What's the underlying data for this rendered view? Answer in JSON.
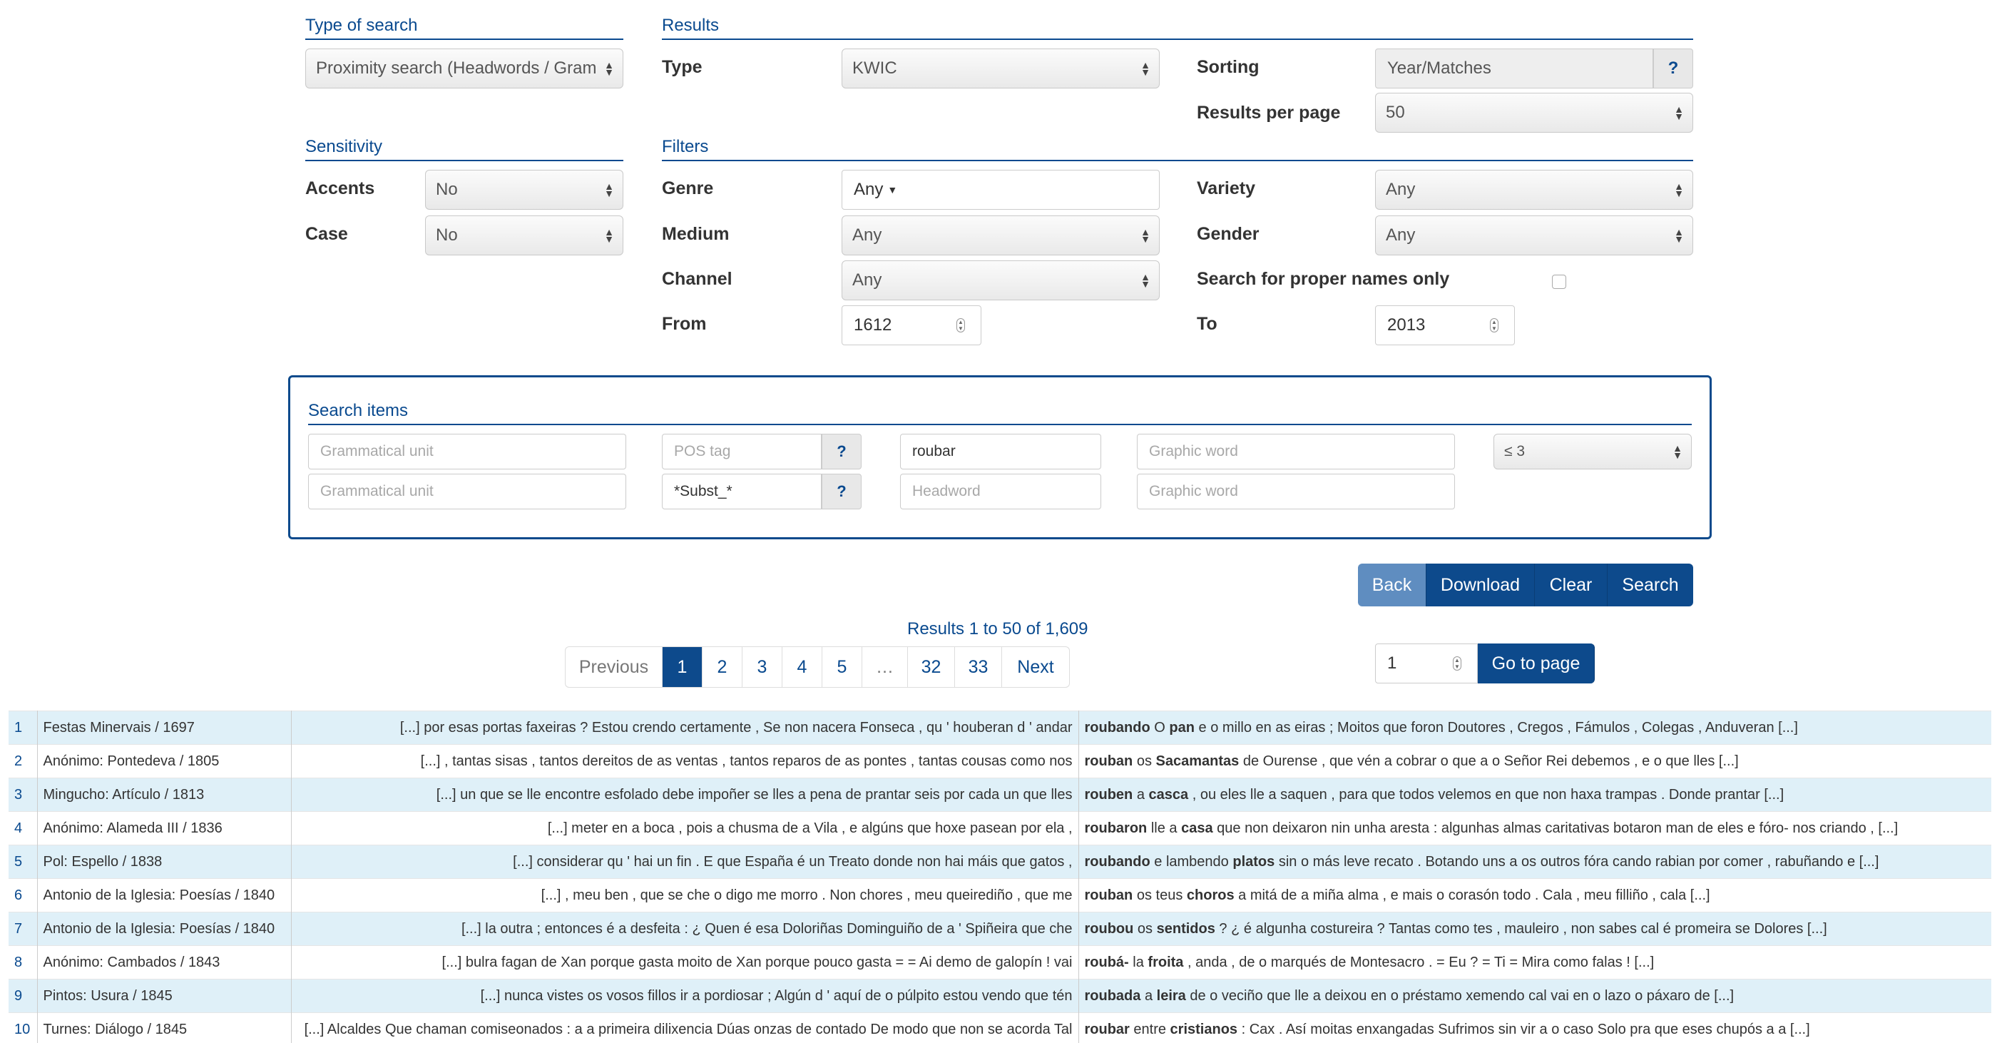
{
  "type_of_search": {
    "heading": "Type of search",
    "value": "Proximity search (Headwords / Gram"
  },
  "results": {
    "heading": "Results",
    "type_label": "Type",
    "type_value": "KWIC",
    "sorting_label": "Sorting",
    "sorting_value": "Year/Matches",
    "sorting_help": "?",
    "per_page_label": "Results per page",
    "per_page_value": "50"
  },
  "sensitivity": {
    "heading": "Sensitivity",
    "accents_label": "Accents",
    "accents_value": "No",
    "case_label": "Case",
    "case_value": "No"
  },
  "filters": {
    "heading": "Filters",
    "genre_label": "Genre",
    "genre_value": "Any",
    "variety_label": "Variety",
    "variety_value": "Any",
    "medium_label": "Medium",
    "medium_value": "Any",
    "gender_label": "Gender",
    "gender_value": "Any",
    "channel_label": "Channel",
    "channel_value": "Any",
    "proper_names_label": "Search for proper names only",
    "from_label": "From",
    "from_value": "1612",
    "to_label": "To",
    "to_value": "2013"
  },
  "search_items": {
    "heading": "Search items",
    "row1": {
      "gram_unit": "Grammatical unit",
      "pos_tag": "POS tag",
      "help": "?",
      "headword": "roubar",
      "graphic_word": "Graphic word",
      "distance": "≤ 3"
    },
    "row2": {
      "gram_unit": "Grammatical unit",
      "pos_tag": "*Subst_*",
      "help": "?",
      "headword": "Headword",
      "graphic_word": "Graphic word"
    }
  },
  "buttons": {
    "back": "Back",
    "download": "Download",
    "clear": "Clear",
    "search": "Search",
    "go_to_page": "Go to page",
    "page_input": "1"
  },
  "summary": "Results 1 to 50 of 1,609",
  "pagination": {
    "previous": "Previous",
    "pages": [
      "1",
      "2",
      "3",
      "4",
      "5",
      "…",
      "32",
      "33"
    ],
    "next": "Next"
  },
  "rows": [
    {
      "n": "1",
      "src": "Festas Minervais / 1697",
      "left": "[...] por esas portas faxeiras ? Estou crendo certamente , Se non nacera Fonseca , qu ' houberan d ' andar",
      "kw": "roubando",
      "mid": " O ",
      "kw2": "pan",
      "rest": " e o millo en as eiras ; Moitos que foron Doutores , Cregos , Fámulos , Colegas , Anduveran [...]"
    },
    {
      "n": "2",
      "src": "Anónimo: Pontedeva / 1805",
      "left": "[...] , tantas sisas , tantos dereitos de as ventas , tantos reparos de as pontes , tantas cousas como nos",
      "kw": "rouban",
      "mid": " os ",
      "kw2": "Sacamantas",
      "rest": " de Ourense , que vén a cobrar o que a o Señor Rei debemos , e o que lles [...]"
    },
    {
      "n": "3",
      "src": "Mingucho: Artículo / 1813",
      "left": "[...] un que se lle encontre esfolado debe impoñer se lles a pena de prantar seis por cada un que lles",
      "kw": "rouben",
      "mid": " a ",
      "kw2": "casca",
      "rest": " , ou eles lle a saquen , para que todos velemos en que non haxa trampas . Donde prantar [...]"
    },
    {
      "n": "4",
      "src": "Anónimo: Alameda III / 1836",
      "left": "[...] meter en a boca , pois a chusma de a Vila , e algúns que hoxe pasean por ela ,",
      "kw": "roubaron",
      "mid": " lle a ",
      "kw2": "casa",
      "rest": " que non deixaron nin unha aresta : algunhas almas caritativas botaron man de eles e fóro- nos criando , [...]"
    },
    {
      "n": "5",
      "src": "Pol: Espello / 1838",
      "left": "[...] considerar qu ' hai un fin . E que España é un Treato donde non hai máis que gatos ,",
      "kw": "roubando",
      "mid": " e lambendo ",
      "kw2": "platos",
      "rest": " sin o más leve recato . Botando uns a os outros fóra cando rabian por comer , rabuñando e [...]"
    },
    {
      "n": "6",
      "src": "Antonio de la Iglesia: Poesías / 1840",
      "left": "[...] , meu ben , que se che o digo me morro . Non chores , meu queirediño , que me",
      "kw": "rouban",
      "mid": " os teus ",
      "kw2": "choros",
      "rest": " a mitá de a miña alma , e mais o corasón todo . Cala , meu filliño , cala [...]"
    },
    {
      "n": "7",
      "src": "Antonio de la Iglesia: Poesías / 1840",
      "left": "[...] la outra ; entonces é a desfeita : ¿ Quen é esa Doloriñas Dominguiño de a ' Spiñeira que che",
      "kw": "roubou",
      "mid": " os ",
      "kw2": "sentidos",
      "rest": " ? ¿ é algunha costureira ? Tantas como tes , mauleiro , non sabes cal é promeira se Dolores [...]"
    },
    {
      "n": "8",
      "src": "Anónimo: Cambados / 1843",
      "left": "[...] bulra fagan de Xan porque gasta moito de Xan porque pouco gasta = = Ai demo de galopín ! vai",
      "kw": "roubá-",
      "mid": " la ",
      "kw2": "froita",
      "rest": " , anda , de o marqués de Montesacro . = Eu ? = Ti = Mira como falas ! [...]"
    },
    {
      "n": "9",
      "src": "Pintos: Usura / 1845",
      "left": "[...] nunca vistes os vosos fillos ir a pordiosar ; Algún d ' aquí de o púlpito estou vendo que tén",
      "kw": "roubada",
      "mid": " a ",
      "kw2": "leira",
      "rest": " de o veciño que lle a deixou en o préstamo xemendo cal vai en o lazo o páxaro de [...]"
    },
    {
      "n": "10",
      "src": "Turnes: Diálogo / 1845",
      "left": "[...] Alcaldes Que chaman comiseonados : a a primeira dilixencia Dúas onzas de contado De modo que non se acorda Tal",
      "kw": "roubar",
      "mid": " entre ",
      "kw2": "cristianos",
      "rest": " : Cax . Así moitas enxangadas Sufrimos sin vir a o caso Solo pra que eses chupós a a [...]"
    }
  ]
}
